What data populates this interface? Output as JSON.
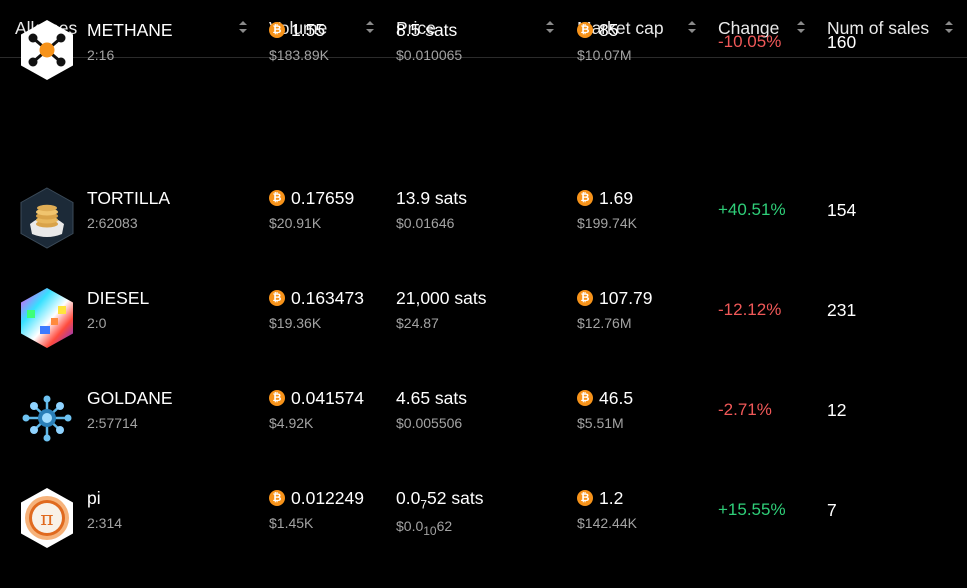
{
  "columns": {
    "alkanes": "Alkanes",
    "volume": "Volume",
    "price": "Price",
    "market_cap": "Market cap",
    "change": "Change",
    "num_sales": "Num of sales"
  },
  "rows": [
    {
      "name": "METHANE",
      "id": "2:16",
      "volume_btc": "1.55",
      "volume_usd": "$183.89K",
      "price_sats": "8.5 sats",
      "price_usd": "$0.010065",
      "mcap_btc": "85",
      "mcap_usd": "$10.07M",
      "change": "-10.05%",
      "change_dir": "negative",
      "sales": "160",
      "icon": "methane-molecule-icon"
    },
    {
      "name": "TORTILLA",
      "id": "2:62083",
      "volume_btc": "0.17659",
      "volume_usd": "$20.91K",
      "price_sats": "13.9 sats",
      "price_usd": "$0.01646",
      "mcap_btc": "1.69",
      "mcap_usd": "$199.74K",
      "change": "+40.51%",
      "change_dir": "positive",
      "sales": "154",
      "icon": "tortilla-stack-icon"
    },
    {
      "name": "DIESEL",
      "id": "2:0",
      "volume_btc": "0.163473",
      "volume_usd": "$19.36K",
      "price_sats": "21,000 sats",
      "price_usd": "$24.87",
      "mcap_btc": "107.79",
      "mcap_usd": "$12.76M",
      "change": "-12.12%",
      "change_dir": "negative",
      "sales": "231",
      "icon": "diesel-rainbow-icon"
    },
    {
      "name": "GOLDANE",
      "id": "2:57714",
      "volume_btc": "0.041574",
      "volume_usd": "$4.92K",
      "price_sats": "4.65 sats",
      "price_usd": "$0.005506",
      "mcap_btc": "46.5",
      "mcap_usd": "$5.51M",
      "change": "-2.71%",
      "change_dir": "negative",
      "sales": "12",
      "icon": "goldane-molecule-icon"
    },
    {
      "name": "pi",
      "id": "2:314",
      "volume_btc": "0.012249",
      "volume_usd": "$1.45K",
      "price_pre": "0.0",
      "price_zero_count": "7",
      "price_post": "52 sats",
      "price_usd_pre": "$0.0",
      "price_usd_zero_count": "10",
      "price_usd_post": "62",
      "mcap_btc": "1.2",
      "mcap_usd": "$142.44K",
      "change": "+15.55%",
      "change_dir": "positive",
      "sales": "7",
      "icon": "pi-symbol-icon"
    }
  ],
  "colors": {
    "positive": "#2fcf79",
    "negative": "#f05858",
    "bitcoin": "#f7931a"
  }
}
